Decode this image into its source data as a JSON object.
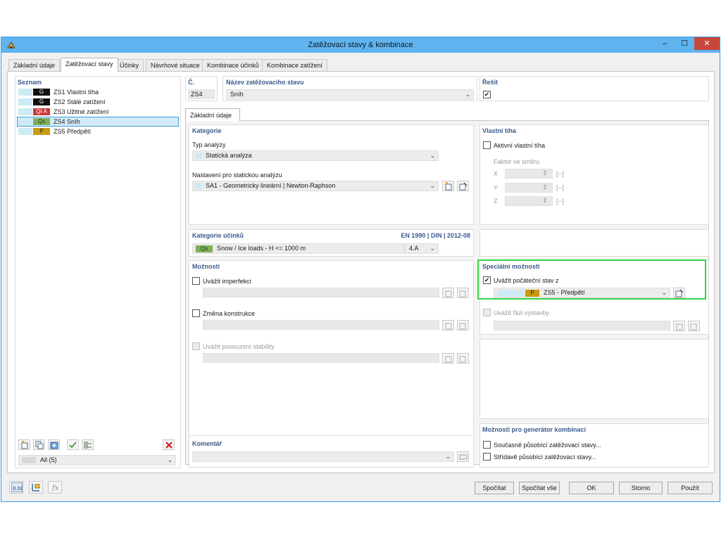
{
  "window": {
    "title": "Zatěžovací stavy & kombinace",
    "minimize": "–",
    "maximize": "☐",
    "close": "✕"
  },
  "tabs": [
    {
      "label": "Základní údaje"
    },
    {
      "label": "Zatěžovací stavy",
      "active": true
    },
    {
      "label": "Účinky"
    },
    {
      "label": "Návrhové situace"
    },
    {
      "label": "Kombinace účinků"
    },
    {
      "label": "Kombinace zatížení"
    }
  ],
  "list": {
    "header": "Seznam",
    "items": [
      {
        "tag": "G",
        "tag_color": "#111111",
        "id": "ZS1",
        "name": "Vlastní tíha"
      },
      {
        "tag": "G",
        "tag_color": "#111111",
        "id": "ZS2",
        "name": "Stálé zatížení"
      },
      {
        "tag": "QI A",
        "tag_color": "#c93a3a",
        "id": "ZS3",
        "name": "Užitné zatížení"
      },
      {
        "tag": "Qs",
        "tag_color": "#7fae5a",
        "id": "ZS4",
        "name": "Sníh",
        "selected": true
      },
      {
        "tag": "P",
        "tag_color": "#c99a10",
        "id": "ZS5",
        "name": "Předpětí"
      }
    ],
    "filter": "All (5)"
  },
  "case": {
    "number_label": "Č.",
    "number_value": "ZS4",
    "name_label": "Název zatěžovacího stavu",
    "name_value": "Sníh",
    "solve_label": "Řešit",
    "solve_checked": "✔"
  },
  "subtab": "Základní údaje",
  "category": {
    "header": "Kategorie",
    "analysis_type_label": "Typ analýzy",
    "analysis_type_value": "Statická analýza",
    "static_settings_label": "Nastavení pro statickou analýzu",
    "static_settings_value": "SA1 - Geometricky lineární | Newton-Raphson"
  },
  "selfweight": {
    "header": "Vlastní tíha",
    "active_label": "Aktivní vlastní tíha",
    "factor_label": "Faktor ve směru",
    "axes": [
      {
        "axis": "X",
        "unit": "[--]"
      },
      {
        "axis": "Y",
        "unit": "[--]"
      },
      {
        "axis": "Z",
        "unit": "[--]"
      }
    ]
  },
  "effect_category": {
    "header": "Kategorie účinků",
    "standard": "EN 1990 | DIN | 2012-08",
    "tag": "Qs",
    "value": "Snow / Ice loads - H <= 1000 m",
    "code": "4.A"
  },
  "options": {
    "header": "Možnosti",
    "imperfection_label": "Uvážit imperfekci",
    "structure_change_label": "Změna konstrukce",
    "stability_label": "Uvážit posouzení stability"
  },
  "special": {
    "header": "Speciální možnosti",
    "initial_state_label": "Uvážit počáteční stav z",
    "initial_state_checked": "✔",
    "initial_state_tag": "P",
    "initial_state_value": "ZS5 - Předpětí",
    "construction_phase_label": "Uvážit fázi výstavby"
  },
  "generator": {
    "header": "Možnosti pro generátor kombinací",
    "simultaneous_label": "Současně působící zatěžovací stavy...",
    "alternating_label": "Střídavě působící zatěžovací stavy..."
  },
  "comment": {
    "header": "Komentář"
  },
  "buttons": {
    "calculate": "Spočítat",
    "calculate_all": "Spočítat vše",
    "ok": "OK",
    "cancel": "Storno",
    "apply": "Použít"
  },
  "status_icons": {
    "numbers_icon": "0.00"
  }
}
